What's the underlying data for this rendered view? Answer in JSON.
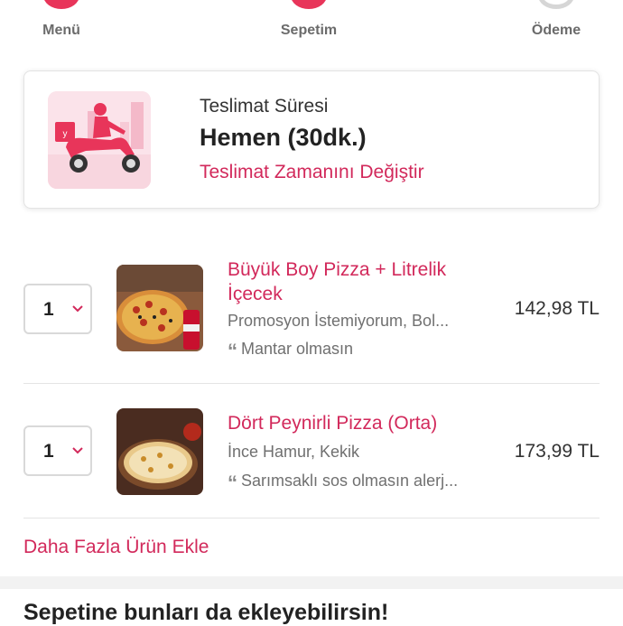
{
  "steps": [
    {
      "label": "Menü",
      "state": "active"
    },
    {
      "label": "Sepetim",
      "state": "active"
    },
    {
      "label": "Ödeme",
      "state": "inactive"
    }
  ],
  "delivery": {
    "title": "Teslimat Süresi",
    "time": "Hemen (30dk.)",
    "change_link": "Teslimat Zamanını Değiştir"
  },
  "items": [
    {
      "quantity": "1",
      "name": "Büyük Boy Pizza + Litrelik İçecek",
      "options": "Promosyon İstemiyorum, Bol...",
      "note": "Mantar olmasın",
      "price": "142,98 TL"
    },
    {
      "quantity": "1",
      "name": "Dört Peynirli Pizza (Orta)",
      "options": "İnce Hamur, Kekik",
      "note": "Sarımsaklı sos olmasın alerj...",
      "price": "173,99 TL"
    }
  ],
  "add_more_label": "Daha Fazla Ürün Ekle",
  "suggestions_title": "Sepetine bunları da ekleyebilirsin!",
  "colors": {
    "accent": "#e8355a",
    "link": "#d2295b",
    "muted": "#707070"
  }
}
